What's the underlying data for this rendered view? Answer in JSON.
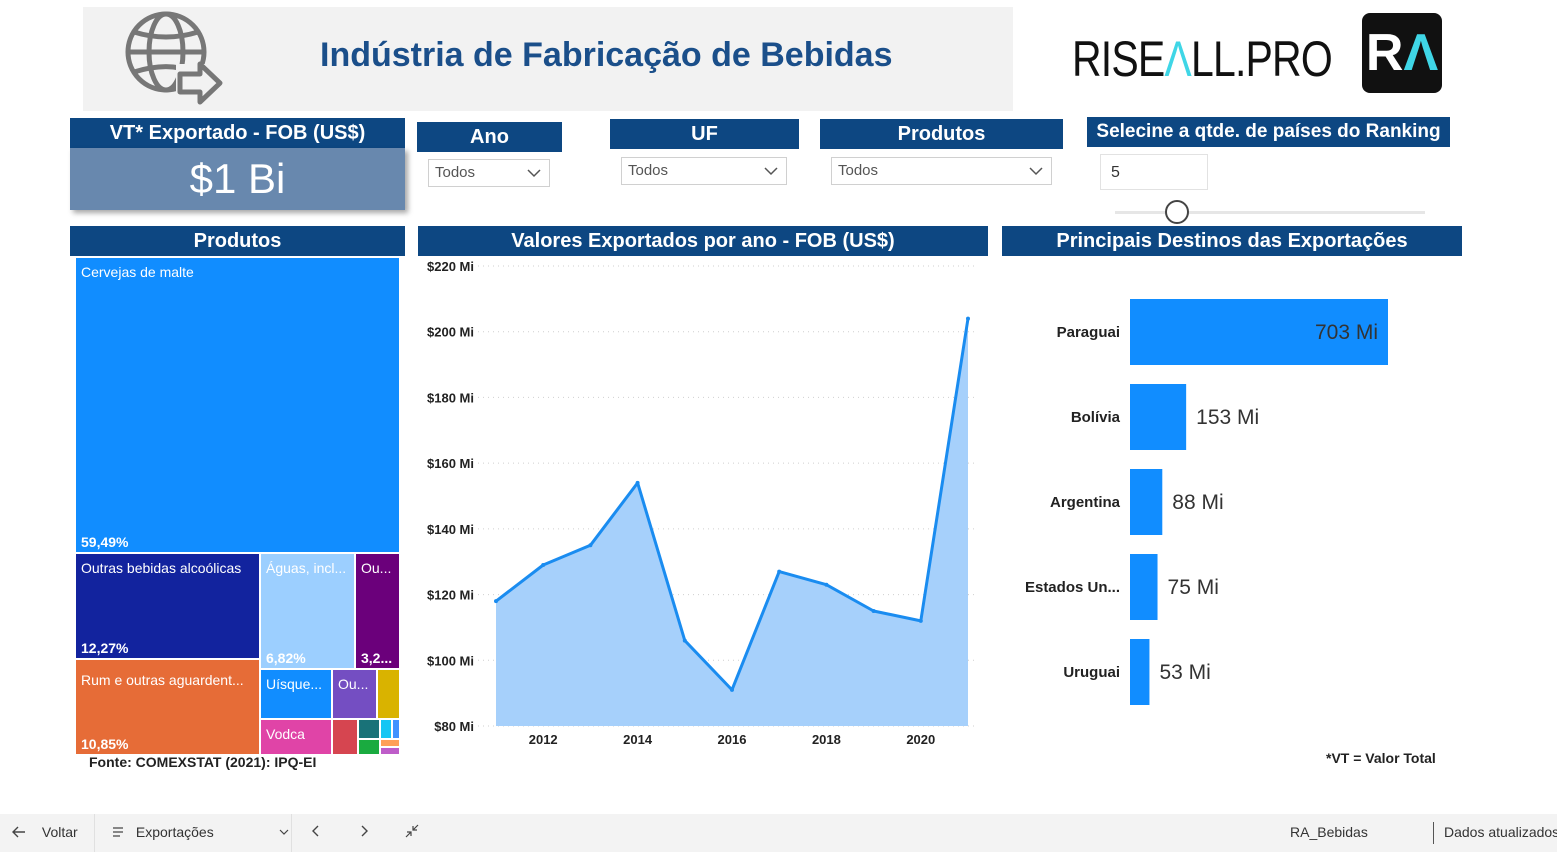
{
  "header": {
    "title": "Indústria de Fabricação de Bebidas",
    "brand_left": "RISE",
    "brand_accent": "Λ",
    "brand_right": "LL.PRO",
    "badge_left": "R",
    "badge_accent": "Λ"
  },
  "kpi": {
    "label": "VT* Exportado - FOB (US$)",
    "value": "$1 Bi"
  },
  "filters": {
    "ano": {
      "label": "Ano",
      "value": "Todos"
    },
    "uf": {
      "label": "UF",
      "value": "Todos"
    },
    "produtos": {
      "label": "Produtos",
      "value": "Todos"
    },
    "ranking": {
      "label": "Selecine a qtde. de países do Ranking",
      "value": "5",
      "slider_fraction": 0.2
    }
  },
  "treemap": {
    "title": "Produtos",
    "items": [
      {
        "name": "Cervejas de malte",
        "pct": "59,49%",
        "color": "#118dff"
      },
      {
        "name": "Outras bebidas alcoólicas",
        "pct": "12,27%",
        "color": "#12239e"
      },
      {
        "name": "Águas, incl...",
        "pct": "6,82%",
        "color": "#9ccfff"
      },
      {
        "name": "Ou...",
        "pct": "3,2...",
        "color": "#6b007b"
      },
      {
        "name": "Rum e outras aguardent...",
        "pct": "10,85%",
        "color": "#e66c37"
      },
      {
        "name": "Uísque...",
        "pct": "",
        "color": "#118dff"
      },
      {
        "name": "Ou...",
        "pct": "",
        "color": "#744ec2"
      },
      {
        "name": "Vodca",
        "pct": "",
        "color": "#e044a7"
      }
    ],
    "minor_colors": [
      "#d9b300",
      "#d64550",
      "#197278",
      "#1aab40",
      "#15c6f4",
      "#4092ff",
      "#ffa058",
      "#be5dc9"
    ]
  },
  "line_chart_title": "Valores Exportados por ano - FOB (US$)",
  "chart_data": [
    {
      "type": "area",
      "title": "Valores Exportados por ano - FOB (US$)",
      "x": [
        2011,
        2012,
        2013,
        2014,
        2015,
        2016,
        2017,
        2018,
        2019,
        2020,
        2021
      ],
      "values": [
        118,
        129,
        135,
        154,
        106,
        91,
        127,
        123,
        115,
        112,
        204
      ],
      "unit": "Mi",
      "ylim": [
        80,
        220
      ],
      "yticks": [
        "$220 Mi",
        "$200 Mi",
        "$180 Mi",
        "$160 Mi",
        "$140 Mi",
        "$120 Mi",
        "$100 Mi",
        "$80 Mi"
      ],
      "xticks": [
        "2012",
        "2014",
        "2016",
        "2018",
        "2020"
      ],
      "grid": true,
      "line_color": "#1a8cf0",
      "fill_color": "#a6d0fb"
    },
    {
      "type": "bar",
      "title": "Principais Destinos das Exportações",
      "categories": [
        "Paraguai",
        "Bolívia",
        "Argentina",
        "Estados Un...",
        "Uruguai"
      ],
      "values": [
        703,
        153,
        88,
        75,
        53
      ],
      "labels": [
        "703 Mi",
        "153 Mi",
        "88 Mi",
        "75 Mi",
        "53 Mi"
      ],
      "bar_color": "#118dff"
    }
  ],
  "destinos_title": "Principais Destinos das Exportações",
  "footer": {
    "fonte": "Fonte: COMEXSTAT (2021): IPQ-EI",
    "vt_note": "*VT = Valor Total"
  },
  "bottombar": {
    "back": "Voltar",
    "page": "Exportações",
    "report": "RA_Bebidas",
    "status": "Dados atualizados"
  }
}
